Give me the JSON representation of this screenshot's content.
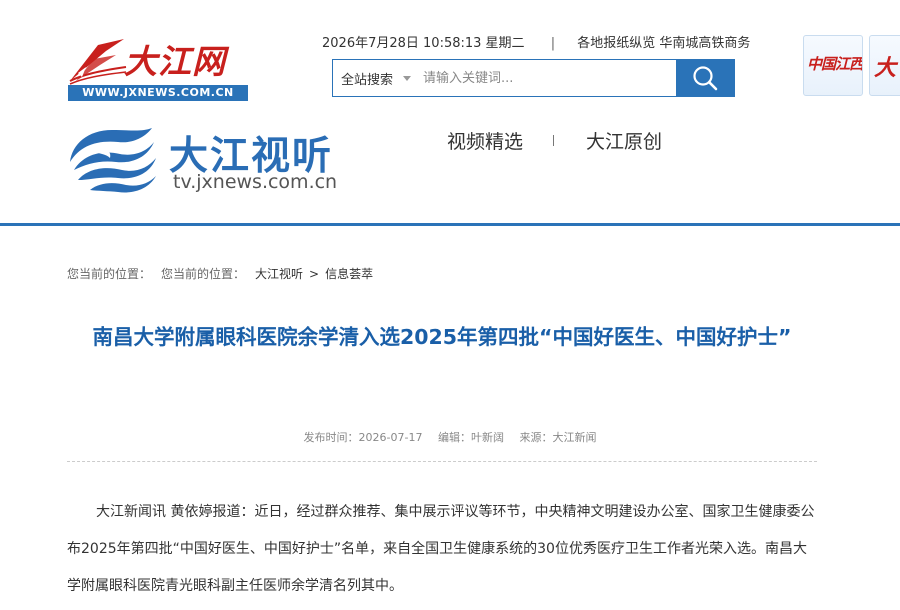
{
  "header": {
    "brand_cn": "大江网",
    "brand_url": "WWW.JXNEWS.COM.CN",
    "datetime": "2026年7月28日 10:58:13 星期二",
    "separator": "|",
    "quick_links": "各地报纸纵览 华南城高铁商务",
    "search": {
      "scope": "全站搜索",
      "placeholder": "请输入关键词..."
    },
    "tiles": [
      {
        "label": "中国江西网"
      },
      {
        "label": "大"
      }
    ]
  },
  "channel": {
    "title": "大江视听",
    "subtitle": "tv.jxnews.com.cn",
    "nav": [
      {
        "label": "视频精选"
      },
      {
        "label": "大江原创"
      }
    ]
  },
  "breadcrumb": {
    "prefix1": "您当前的位置：",
    "prefix2": "您当前的位置：",
    "items": [
      "大江视听",
      "信息荟萃"
    ],
    "separator": ">"
  },
  "article": {
    "title": "南昌大学附属眼科医院余学清入选2025年第四批“中国好医生、中国好护士”",
    "publish_time": "发布时间：2026-07-17",
    "editor": "编辑：叶新阔",
    "source": "来源：大江新闻",
    "paragraph": "大江新闻讯 黄依婷报道：近日，经过群众推荐、集中展示评议等环节，中央精神文明建设办公室、国家卫生健康委公布2025年第四批“中国好医生、中国好护士”名单，来自全国卫生健康系统的30位优秀医疗卫生工作者光荣入选。南昌大学附属眼科医院青光眼科副主任医师余学清名列其中。"
  },
  "colors": {
    "brand_blue": "#2a73b8",
    "headline_blue": "#1a5fa8",
    "brand_red": "#c8201d"
  }
}
